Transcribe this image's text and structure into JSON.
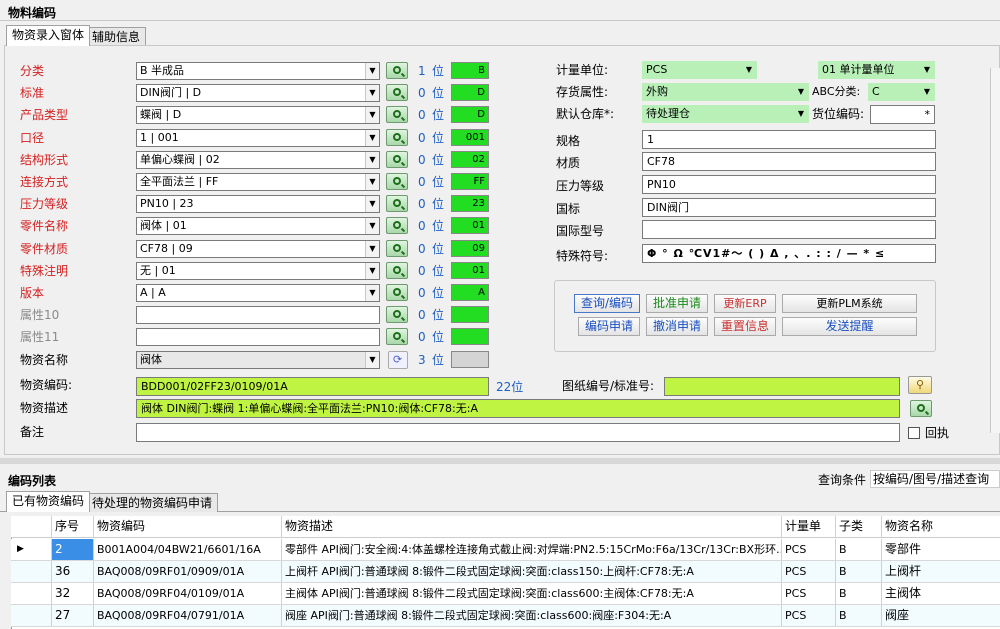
{
  "window_title": "物料编码",
  "tabs": [
    "物资录入窗体",
    "辅助信息"
  ],
  "left_fields": [
    {
      "label": "分类",
      "value": "B 半成品",
      "count": "1",
      "unit": "位",
      "code": "B",
      "color": "red"
    },
    {
      "label": "标准",
      "value": "DIN阀门 | D",
      "count": "0",
      "unit": "位",
      "code": "D",
      "color": "red"
    },
    {
      "label": "产品类型",
      "value": "蝶阀 | D",
      "count": "0",
      "unit": "位",
      "code": "D",
      "color": "red"
    },
    {
      "label": "口径",
      "value": "1 | 001",
      "count": "0",
      "unit": "位",
      "code": "001",
      "color": "red"
    },
    {
      "label": "结构形式",
      "value": "单偏心蝶阀 | 02",
      "count": "0",
      "unit": "位",
      "code": "02",
      "color": "red"
    },
    {
      "label": "连接方式",
      "value": "全平面法兰 | FF",
      "count": "0",
      "unit": "位",
      "code": "FF",
      "color": "red"
    },
    {
      "label": "压力等级",
      "value": "PN10 | 23",
      "count": "0",
      "unit": "位",
      "code": "23",
      "color": "red"
    },
    {
      "label": "零件名称",
      "value": "阀体 | 01",
      "count": "0",
      "unit": "位",
      "code": "01",
      "color": "red"
    },
    {
      "label": "零件材质",
      "value": "CF78 | 09",
      "count": "0",
      "unit": "位",
      "code": "09",
      "color": "red"
    },
    {
      "label": "特殊注明",
      "value": "无 | 01",
      "count": "0",
      "unit": "位",
      "code": "01",
      "color": "red"
    },
    {
      "label": "版本",
      "value": "A | A",
      "count": "0",
      "unit": "位",
      "code": "A",
      "color": "red"
    },
    {
      "label": "属性10",
      "value": "",
      "count": "0",
      "unit": "位",
      "code": "",
      "color": "gray"
    },
    {
      "label": "属性11",
      "value": "",
      "count": "0",
      "unit": "位",
      "code": "",
      "color": "gray"
    },
    {
      "label": "物资名称",
      "value": "阀体",
      "count": "3",
      "unit": "位",
      "code": "",
      "color": "black"
    }
  ],
  "material_code_label": "物资编码:",
  "material_code_value": "BDD001/02FF23/0109/01A",
  "material_code_len": "22位",
  "material_desc_label": "物资描述",
  "material_desc_value": "阀体  DIN阀门:蝶阀  1:单偏心蝶阀:全平面法兰:PN10:阀体:CF78:无:A",
  "remark_label": "备注",
  "remark_value": "",
  "return_label": "回执",
  "drawing_label": "图纸编号/标准号:",
  "drawing_value": "",
  "right": {
    "uom_label": "计量单位:",
    "uom_value": "PCS",
    "uom_type": "01 单计量单位",
    "stock_attr_label": "存货属性:",
    "stock_attr_value": "外购",
    "abc_label": "ABC分类:",
    "abc_value": "C",
    "warehouse_label": "默认仓库*:",
    "warehouse_value": "待处理仓",
    "location_label": "货位编码:",
    "location_value": "*",
    "spec_label": "规格",
    "spec_value": "1",
    "material_label": "材质",
    "material_value": "CF78",
    "pressure_label": "压力等级",
    "pressure_value": "PN10",
    "national_label": "国标",
    "national_value": "DIN阀门",
    "intl_label": "国际型号",
    "intl_value": "",
    "special_label": "特殊符号:",
    "special_value": "Φ ° Ω ℃V1#～ ( ) Δ , 、. : : / — * ≤"
  },
  "buttons": {
    "query": "查询/编码",
    "approve": "批准申请",
    "update_erp": "更新ERP",
    "update_plm": "更新PLM系统",
    "apply": "编码申请",
    "cancel": "撤消申请",
    "reset": "重置信息",
    "remind": "发送提醒"
  },
  "list": {
    "title": "编码列表",
    "query_label": "查询条件",
    "query_value": "按编码/图号/描述查询",
    "tabs": [
      "已有物资编码",
      "待处理的物资编码申请"
    ],
    "columns": [
      "序号",
      "物资编码",
      "物资描述",
      "计量单",
      "子类",
      "物资名称"
    ],
    "rows": [
      {
        "no": "2",
        "code": "B001A004/04BW21/6601/16A",
        "desc": "零部件  API阀门:安全阀:4:体盖螺栓连接角式截止阀:对焊端:PN2.5:15CrMo:F6a/13Cr/13Cr:BX形环...",
        "uom": "PCS",
        "sub": "B",
        "name": "零部件"
      },
      {
        "no": "36",
        "code": "BAQ008/09RF01/0909/01A",
        "desc": "上阀杆  API阀门:普通球阀  8:锻件二段式固定球阀:突面:class150:上阀杆:CF78:无:A",
        "uom": "PCS",
        "sub": "B",
        "name": "上阀杆"
      },
      {
        "no": "32",
        "code": "BAQ008/09RF04/0109/01A",
        "desc": "主阀体  API阀门:普通球阀  8:锻件二段式固定球阀:突面:class600:主阀体:CF78:无:A",
        "uom": "PCS",
        "sub": "B",
        "name": "主阀体"
      },
      {
        "no": "27",
        "code": "BAQ008/09RF04/0791/01A",
        "desc": "阀座  API阀门:普通球阀  8:锻件二段式固定球阀:突面:class600:阀座:F304:无:A",
        "uom": "PCS",
        "sub": "B",
        "name": "阀座"
      }
    ]
  },
  "colors": {
    "green_code": "#22dd22",
    "green_field": "#b8f0b8",
    "lime_field": "#bff542",
    "red_label": "#d42020",
    "link_blue": "#1f5fc0"
  }
}
